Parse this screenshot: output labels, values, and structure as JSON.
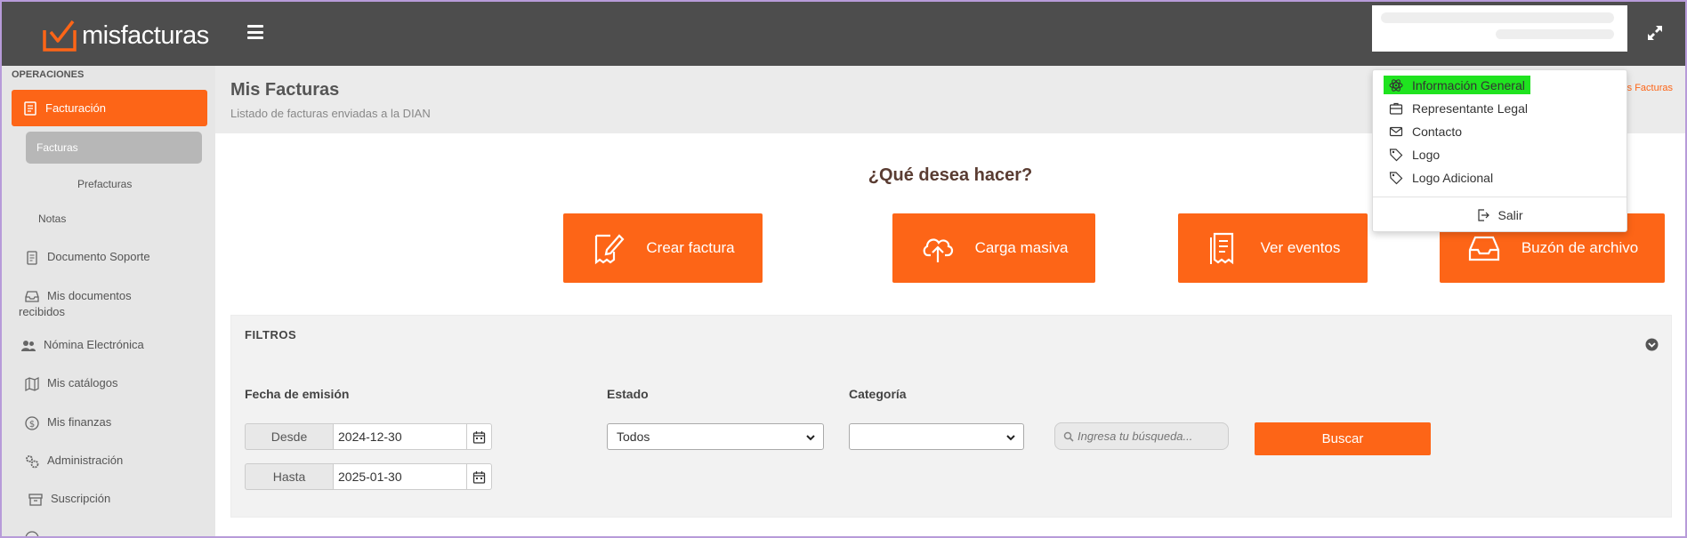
{
  "brand": {
    "name": "misfacturas",
    "accent": "#fd6517",
    "topbar_bg": "#4d4d4d",
    "highlight": "#1fe31f"
  },
  "sidebar": {
    "section": "OPERACIONES",
    "active": {
      "label": "Facturación",
      "icon": "invoice-icon"
    },
    "sub_active": "Facturas",
    "sub_items": [
      "Prefacturas",
      "Notas"
    ],
    "items": [
      {
        "label": "Documento Soporte",
        "icon": "document-icon"
      },
      {
        "label": "Mis documentos recibidos",
        "icon": "inbox-icon"
      },
      {
        "label": "Nómina Electrónica",
        "icon": "users-icon"
      },
      {
        "label": "Mis catálogos",
        "icon": "map-icon"
      },
      {
        "label": "Mis finanzas",
        "icon": "dollar-icon"
      },
      {
        "label": "Administración",
        "icon": "gears-icon"
      },
      {
        "label": "Suscripción",
        "icon": "archive-icon"
      }
    ]
  },
  "header": {
    "title": "Mis Facturas",
    "subtitle": "Listado de facturas enviadas a la DIAN",
    "breadcrumb": "s Facturas"
  },
  "main": {
    "question": "¿Qué desea hacer?",
    "actions": [
      {
        "label": "Crear factura",
        "icon": "edit-invoice-icon"
      },
      {
        "label": "Carga masiva",
        "icon": "cloud-upload-icon"
      },
      {
        "label": "Ver eventos",
        "icon": "receipt-icon"
      },
      {
        "label": "Buzón de archivo",
        "icon": "tray-icon"
      }
    ]
  },
  "filters": {
    "title": "FILTROS",
    "fecha_label": "Fecha de emisión",
    "desde_label": "Desde",
    "desde_value": "2024-12-30",
    "hasta_label": "Hasta",
    "hasta_value": "2025-01-30",
    "estado_label": "Estado",
    "estado_value": "Todos",
    "categoria_label": "Categoría",
    "categoria_value": "",
    "search_placeholder": "Ingresa tu búsqueda...",
    "buscar_label": "Buscar"
  },
  "user_menu": {
    "items": [
      {
        "label": "Información General",
        "icon": "atom-icon",
        "highlighted": true
      },
      {
        "label": "Representante Legal",
        "icon": "id-card-icon"
      },
      {
        "label": "Contacto",
        "icon": "envelope-icon"
      },
      {
        "label": "Logo",
        "icon": "tag-icon"
      },
      {
        "label": "Logo Adicional",
        "icon": "tag-icon"
      }
    ],
    "logout": "Salir"
  }
}
